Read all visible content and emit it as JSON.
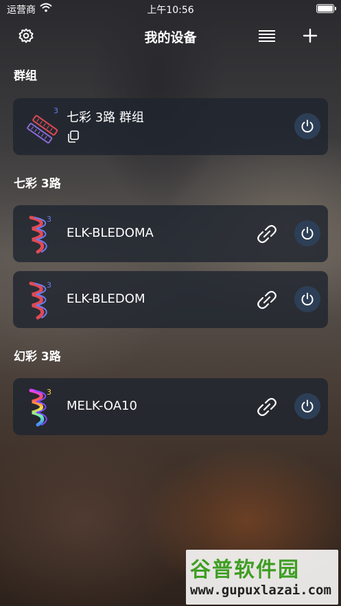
{
  "status_bar": {
    "carrier": "运营商",
    "time": "上午10:56"
  },
  "header": {
    "title": "我的设备",
    "settings_icon": "gear-icon",
    "list_icon": "list-icon",
    "add_icon": "plus-icon"
  },
  "sections": [
    {
      "title": "群组",
      "items": [
        {
          "name": "七彩 3路 群组",
          "icon": "strip-group-icon",
          "badge": "3"
        }
      ]
    },
    {
      "title": "七彩 3路",
      "items": [
        {
          "name": "ELK-BLEDOMA",
          "icon": "strip-icon",
          "badge": "3"
        },
        {
          "name": "ELK-BLEDOM",
          "icon": "strip-icon",
          "badge": "3"
        }
      ]
    },
    {
      "title": "幻彩 3路",
      "items": [
        {
          "name": "MELK-OA10",
          "icon": "strip-rainbow-icon",
          "badge": "3"
        }
      ]
    }
  ],
  "watermark": {
    "main": "谷普软件园",
    "url": "www.gupuxlazai.com"
  },
  "colors": {
    "card": "#1e242e",
    "power_button": "#2d3f56",
    "strip_red": "#e04a55",
    "strip_blue": "#6a7bf0",
    "watermark_green": "#3e9e22",
    "watermark_red": "#c8281e"
  }
}
